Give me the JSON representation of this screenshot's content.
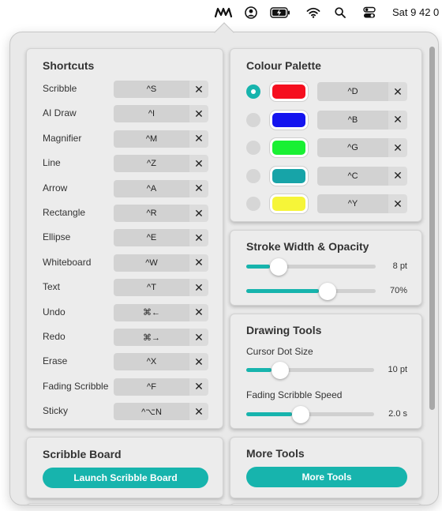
{
  "menubar": {
    "app_icon": "scribble-app-icon",
    "icons": [
      "user-circle-icon",
      "battery-charging-icon",
      "wifi-icon",
      "search-icon",
      "control-center-icon"
    ],
    "clock": "Sat 9 42 0"
  },
  "shortcuts": {
    "title": "Shortcuts",
    "items": [
      {
        "label": "Scribble",
        "key": "^S",
        "clear": "✕"
      },
      {
        "label": "AI Draw",
        "key": "^I",
        "clear": "✕"
      },
      {
        "label": "Magnifier",
        "key": "^M",
        "clear": "✕"
      },
      {
        "label": "Line",
        "key": "^Z",
        "clear": "✕"
      },
      {
        "label": "Arrow",
        "key": "^A",
        "clear": "✕"
      },
      {
        "label": "Rectangle",
        "key": "^R",
        "clear": "✕"
      },
      {
        "label": "Ellipse",
        "key": "^E",
        "clear": "✕"
      },
      {
        "label": "Whiteboard",
        "key": "^W",
        "clear": "✕"
      },
      {
        "label": "Text",
        "key": "^T",
        "clear": "✕"
      },
      {
        "label": "Undo",
        "key": "⌘←",
        "clear": "✕"
      },
      {
        "label": "Redo",
        "key": "⌘→",
        "clear": "✕"
      },
      {
        "label": "Erase",
        "key": "^X",
        "clear": "✕"
      },
      {
        "label": "Fading Scribble",
        "key": "^F",
        "clear": "✕"
      },
      {
        "label": "Sticky",
        "key": "^⌥N",
        "clear": "✕"
      }
    ]
  },
  "palette": {
    "title": "Colour Palette",
    "items": [
      {
        "color": "#f50f1f",
        "key": "^D",
        "clear": "✕",
        "selected": true
      },
      {
        "color": "#1414ef",
        "key": "^B",
        "clear": "✕",
        "selected": false
      },
      {
        "color": "#19f033",
        "key": "^G",
        "clear": "✕",
        "selected": false
      },
      {
        "color": "#17a4a8",
        "key": "^C",
        "clear": "✕",
        "selected": false
      },
      {
        "color": "#f6f538",
        "key": "^Y",
        "clear": "✕",
        "selected": false
      }
    ]
  },
  "stroke": {
    "title": "Stroke Width & Opacity",
    "width_value": "8 pt",
    "width_fraction": 0.18,
    "opacity_value": "70%",
    "opacity_fraction": 0.56
  },
  "drawing_tools": {
    "title": "Drawing Tools",
    "cursor_label": "Cursor Dot Size",
    "cursor_value": "10 pt",
    "cursor_fraction": 0.2,
    "fading_label": "Fading Scribble Speed",
    "fading_value": "2.0 s",
    "fading_fraction": 0.36
  },
  "scribble_board": {
    "title": "Scribble Board",
    "button": "Launch Scribble Board"
  },
  "more_tools": {
    "title": "More Tools",
    "button": "More Tools"
  },
  "colors": {
    "accent": "#17b4ad"
  }
}
